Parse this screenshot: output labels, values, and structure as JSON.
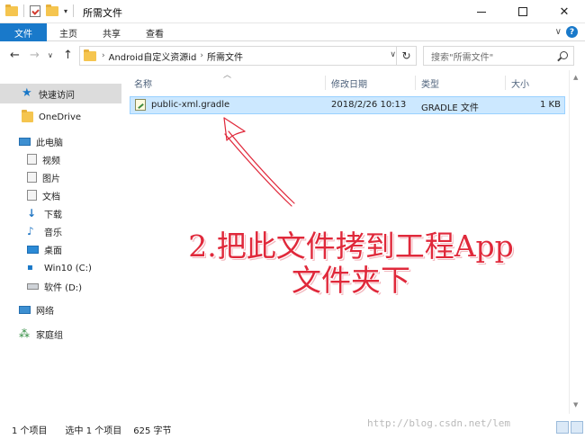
{
  "window": {
    "title": "所需文件",
    "minimize": "",
    "maximize": "",
    "close": "✕"
  },
  "ribbon": {
    "tabs": [
      "文件",
      "主页",
      "共享",
      "查看"
    ],
    "toggle": "∨",
    "help": "?"
  },
  "address": {
    "back": "←",
    "forward": "→",
    "recent": "∨",
    "up": "↑",
    "crumbs": [
      "Android自定义资源id",
      "所需文件"
    ],
    "refresh": "↻",
    "search_placeholder": "搜索\"所需文件\""
  },
  "nav": {
    "items": [
      {
        "label": "快速访问",
        "icon": "star-icon"
      },
      {
        "label": "OneDrive",
        "icon": "folder-icon"
      },
      {
        "label": "此电脑",
        "icon": "computer-icon"
      },
      {
        "label": "视频",
        "icon": "video-icon"
      },
      {
        "label": "图片",
        "icon": "picture-icon"
      },
      {
        "label": "文档",
        "icon": "document-icon"
      },
      {
        "label": "下载",
        "icon": "download-icon"
      },
      {
        "label": "音乐",
        "icon": "music-icon"
      },
      {
        "label": "桌面",
        "icon": "desktop-icon"
      },
      {
        "label": "Win10 (C:)",
        "icon": "drive-icon"
      },
      {
        "label": "软件 (D:)",
        "icon": "drive-icon"
      },
      {
        "label": "网络",
        "icon": "network-icon"
      },
      {
        "label": "家庭组",
        "icon": "homegroup-icon"
      }
    ]
  },
  "list": {
    "columns": [
      "名称",
      "修改日期",
      "类型",
      "大小"
    ],
    "rows": [
      {
        "name": "public-xml.gradle",
        "modified": "2018/2/26 10:13",
        "type": "GRADLE 文件",
        "size": "1 KB"
      }
    ]
  },
  "annotation": {
    "line1": "2.把此文件拷到工程App",
    "line2": "文件夹下",
    "color": "#e0293b"
  },
  "status": {
    "count": "1 个项目",
    "selected": "选中 1 个项目",
    "size": "625 字节"
  },
  "watermark": "http://blog.csdn.net/lem",
  "colors": {
    "accent": "#1979ca",
    "selection": "#cce8ff"
  }
}
